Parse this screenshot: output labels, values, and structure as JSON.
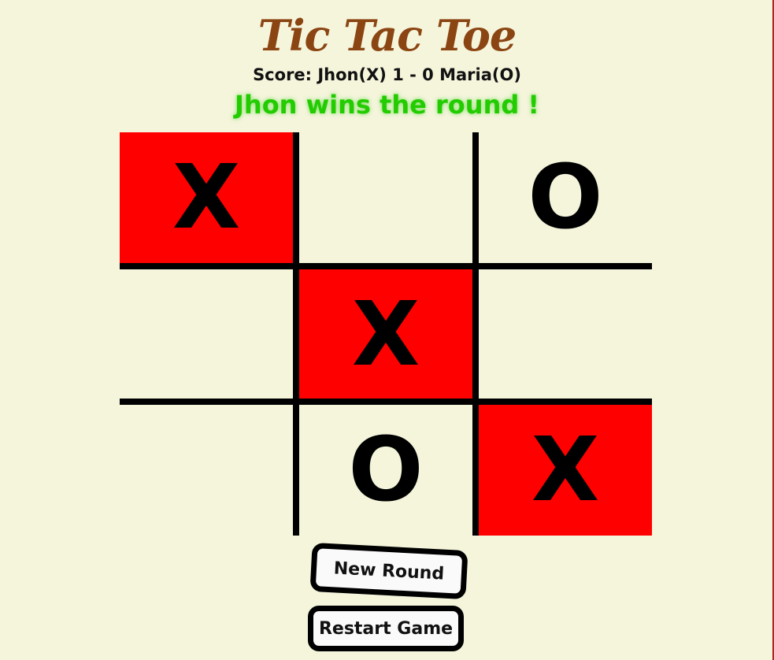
{
  "title": "Tic Tac Toe",
  "score_text": "Score: Jhon(X) 1 - 0 Maria(O)",
  "status_text": "Jhon wins the round !",
  "board": {
    "cells": [
      {
        "mark": "X",
        "winning": true
      },
      {
        "mark": "",
        "winning": false
      },
      {
        "mark": "O",
        "winning": false
      },
      {
        "mark": "",
        "winning": false
      },
      {
        "mark": "X",
        "winning": true
      },
      {
        "mark": "",
        "winning": false
      },
      {
        "mark": "",
        "winning": false
      },
      {
        "mark": "O",
        "winning": false
      },
      {
        "mark": "X",
        "winning": true
      }
    ]
  },
  "buttons": {
    "new_round": "New Round",
    "restart_game": "Restart Game"
  },
  "colors": {
    "background": "#f5f5dc",
    "title": "#8b4513",
    "status": "#22cc00",
    "winning_cell": "#ff0000",
    "grid": "#000000"
  }
}
